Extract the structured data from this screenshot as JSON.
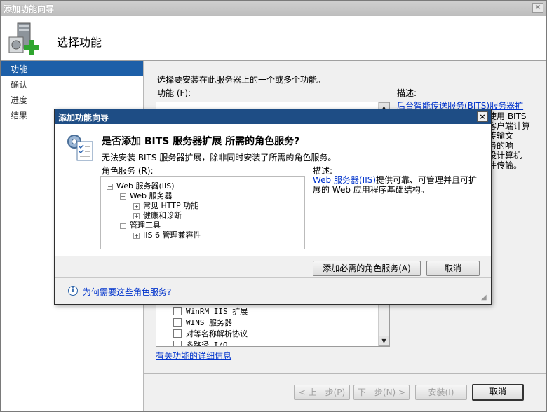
{
  "window": {
    "title": "添加功能向导",
    "header_title": "选择功能"
  },
  "nav": {
    "items": [
      {
        "label": "功能",
        "active": true
      },
      {
        "label": "确认",
        "active": false
      },
      {
        "label": "进度",
        "active": false
      },
      {
        "label": "结果",
        "active": false
      }
    ]
  },
  "main": {
    "instruction": "选择要安装在此服务器上的一个或多个功能。",
    "features_label": "功能 (F):",
    "description_label": "描述:",
    "description_link": "后台智能传送服务(BITS)服务器扩",
    "description_lines": [
      "使用 BITS",
      "客户端计算",
      "传输文",
      "务的响",
      "设计算机",
      "件传输。"
    ],
    "feature_rows": [
      {
        "label": "WinRM IIS 扩展"
      },
      {
        "label": "WINS 服务器"
      },
      {
        "label": "对等名称解析协议"
      },
      {
        "label": "多路径 I/O"
      }
    ],
    "more_info_link": "有关功能的详细信息"
  },
  "footer": {
    "prev": "< 上一步(P)",
    "next": "下一步(N) >",
    "install": "安装(I)",
    "cancel": "取消"
  },
  "dialog": {
    "title": "添加功能向导",
    "heading": "是否添加 BITS 服务器扩展 所需的角色服务?",
    "message": "无法安装 BITS 服务器扩展，除非同时安装了所需的角色服务。",
    "roles_label": "角色服务 (R):",
    "description_label": "描述:",
    "description_link": "Web 服务器(IIS)",
    "description_text": "提供可靠、可管理并且可扩展的 Web 应用程序基础结构。",
    "tree": [
      {
        "label": "Web 服务器(IIS)",
        "level": 0,
        "sign": "−"
      },
      {
        "label": "Web 服务器",
        "level": 1,
        "sign": "−"
      },
      {
        "label": "常见 HTTP 功能",
        "level": 2,
        "sign": "+"
      },
      {
        "label": "健康和诊断",
        "level": 2,
        "sign": "+"
      },
      {
        "label": "管理工具",
        "level": 1,
        "sign": "−"
      },
      {
        "label": "IIS 6 管理兼容性",
        "level": 2,
        "sign": "+"
      }
    ],
    "add_button": "添加必需的角色服务(A)",
    "cancel_button": "取消",
    "help_link": "为何需要这些角色服务?",
    "close_glyph": "×"
  },
  "colors": {
    "title_bar": "#1e4d85",
    "nav_active": "#1d5fa8",
    "link": "#0033cc"
  }
}
